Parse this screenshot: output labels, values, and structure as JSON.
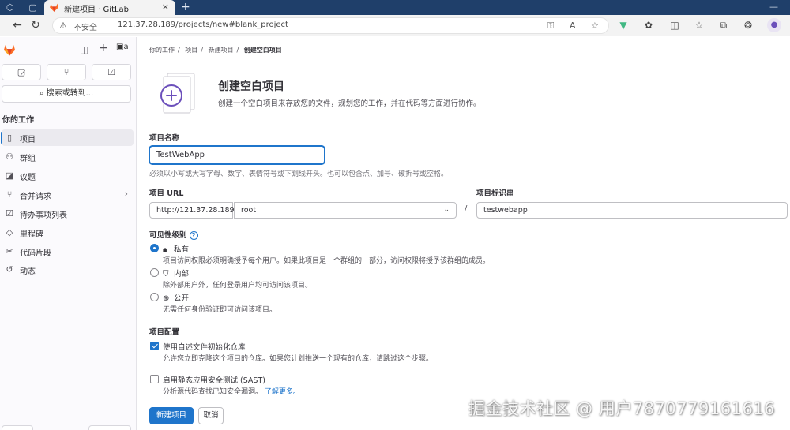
{
  "browser": {
    "tab_title": "新建项目 · GitLab",
    "tab_close": "×",
    "new_tab": "+",
    "security_label": "不安全",
    "url": "121.37.28.189/projects/new#blank_project"
  },
  "sidebar": {
    "avatar_alt": "a",
    "search_label": "搜索或转到...",
    "section_title": "你的工作",
    "items": [
      {
        "label": "项目",
        "icon": "project-icon",
        "active": true
      },
      {
        "label": "群组",
        "icon": "group-icon"
      },
      {
        "label": "议题",
        "icon": "issues-icon"
      },
      {
        "label": "合并请求",
        "icon": "merge-request-icon",
        "has_chevron": true
      },
      {
        "label": "待办事项列表",
        "icon": "todo-icon"
      },
      {
        "label": "里程碑",
        "icon": "milestone-icon"
      },
      {
        "label": "代码片段",
        "icon": "snippet-icon"
      },
      {
        "label": "动态",
        "icon": "activity-icon"
      }
    ]
  },
  "breadcrumb": [
    "你的工作",
    "项目",
    "新建项目",
    "创建空白项目"
  ],
  "header": {
    "title": "创建空白项目",
    "subtitle": "创建一个空白项目来存放您的文件，规划您的工作，并在代码等方面进行协作。"
  },
  "form": {
    "name_label": "项目名称",
    "name_value": "TestWebApp",
    "name_help": "必须以小写或大写字母、数字、表情符号或下划线开头。也可以包含点、加号、破折号或空格。",
    "url_label": "项目 URL",
    "url_prefix": "http://121.37.28.189/",
    "namespace": "root",
    "url_separator": "/",
    "slug_label": "项目标识串",
    "slug_value": "testwebapp",
    "visibility_label": "可见性级别",
    "visibility_options": [
      {
        "label": "私有",
        "icon": "lock-icon",
        "desc": "项目访问权限必须明确授予每个用户。如果此项目是一个群组的一部分，访问权限将授予该群组的成员。",
        "checked": true
      },
      {
        "label": "内部",
        "icon": "shield-icon",
        "desc": "除外部用户外，任何登录用户均可访问该项目。",
        "checked": false
      },
      {
        "label": "公开",
        "icon": "earth-icon",
        "desc": "无需任何身份验证即可访问该项目。",
        "checked": false
      }
    ],
    "config_label": "项目配置",
    "options": [
      {
        "label": "使用自述文件初始化仓库",
        "desc": "允许您立即克隆这个项目的仓库。如果您计划推送一个现有的仓库，请跳过这个步骤。",
        "checked": true
      },
      {
        "label": "启用静态应用安全测试 (SAST)",
        "desc": "分析源代码查找已知安全漏洞。",
        "link": "了解更多。",
        "checked": false
      }
    ],
    "submit_label": "新建项目",
    "cancel_label": "取消"
  },
  "watermark": "掘金技术社区 @ 用户7870779161616",
  "colors": {
    "accent": "#1f75cb",
    "tabbar": "#1f3f6a",
    "brand_orange": "#fc6d26",
    "illustration_purple": "#6b4fbb"
  }
}
